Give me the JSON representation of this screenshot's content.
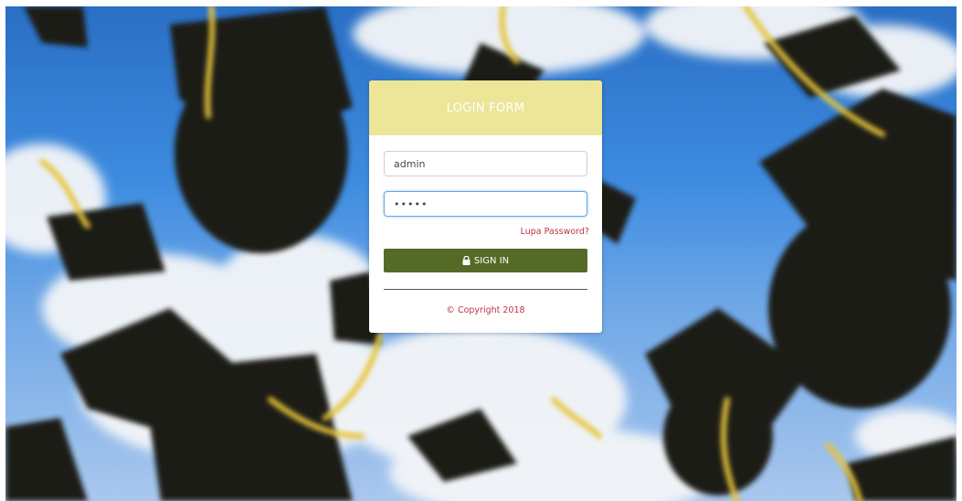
{
  "colors": {
    "header_bg": "#ede597",
    "button_bg": "#566a28",
    "accent_text": "#c0334a",
    "focus_border": "#66a7e6"
  },
  "background": {
    "description_icon": "graduation-caps-photo"
  },
  "login_form": {
    "title": "LOGIN FORM",
    "username_value": "admin",
    "password_value": "•••••",
    "forgot_password_label": "Lupa Password?",
    "signin_icon": "lock-icon",
    "signin_label": "SIGN IN",
    "copyright_text": "© Copyright 2018"
  }
}
